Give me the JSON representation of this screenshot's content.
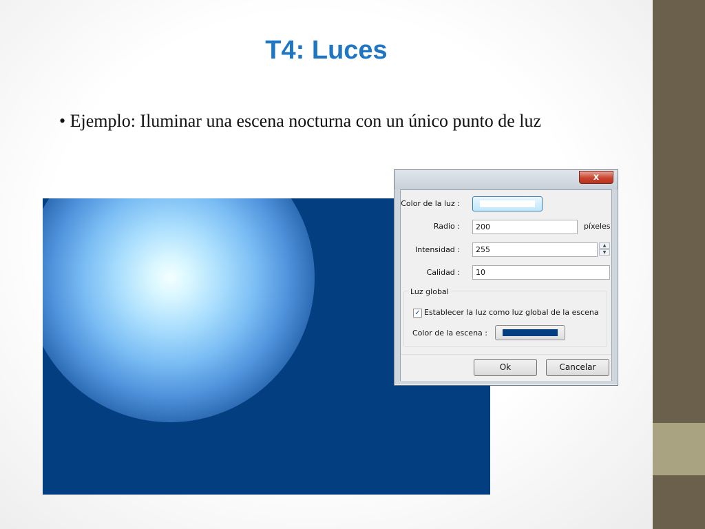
{
  "slide": {
    "title": "T4: Luces",
    "bullet": "• Ejemplo: Iluminar una escena nocturna con un único punto de luz"
  },
  "colors": {
    "scene_background": "#033f80",
    "title_color": "#1f76c3",
    "sidebar": "#6a604b",
    "sidebar_accent": "#a9a381"
  },
  "dialog": {
    "close_label": "x",
    "fields": {
      "light_color_label": "Color de la luz :",
      "light_color_value": "#ffffff",
      "radius_label": "Radio :",
      "radius_value": "200",
      "radius_unit": "píxeles",
      "intensity_label": "Intensidad :",
      "intensity_value": "255",
      "quality_label": "Calidad :",
      "quality_value": "10"
    },
    "global": {
      "group_label": "Luz global",
      "checkbox_label": "Establecer la luz como luz global de la escena",
      "checked": true,
      "scene_color_label": "Color de la escena :",
      "scene_color_value": "#033f80"
    },
    "buttons": {
      "ok": "Ok",
      "cancel": "Cancelar"
    }
  }
}
